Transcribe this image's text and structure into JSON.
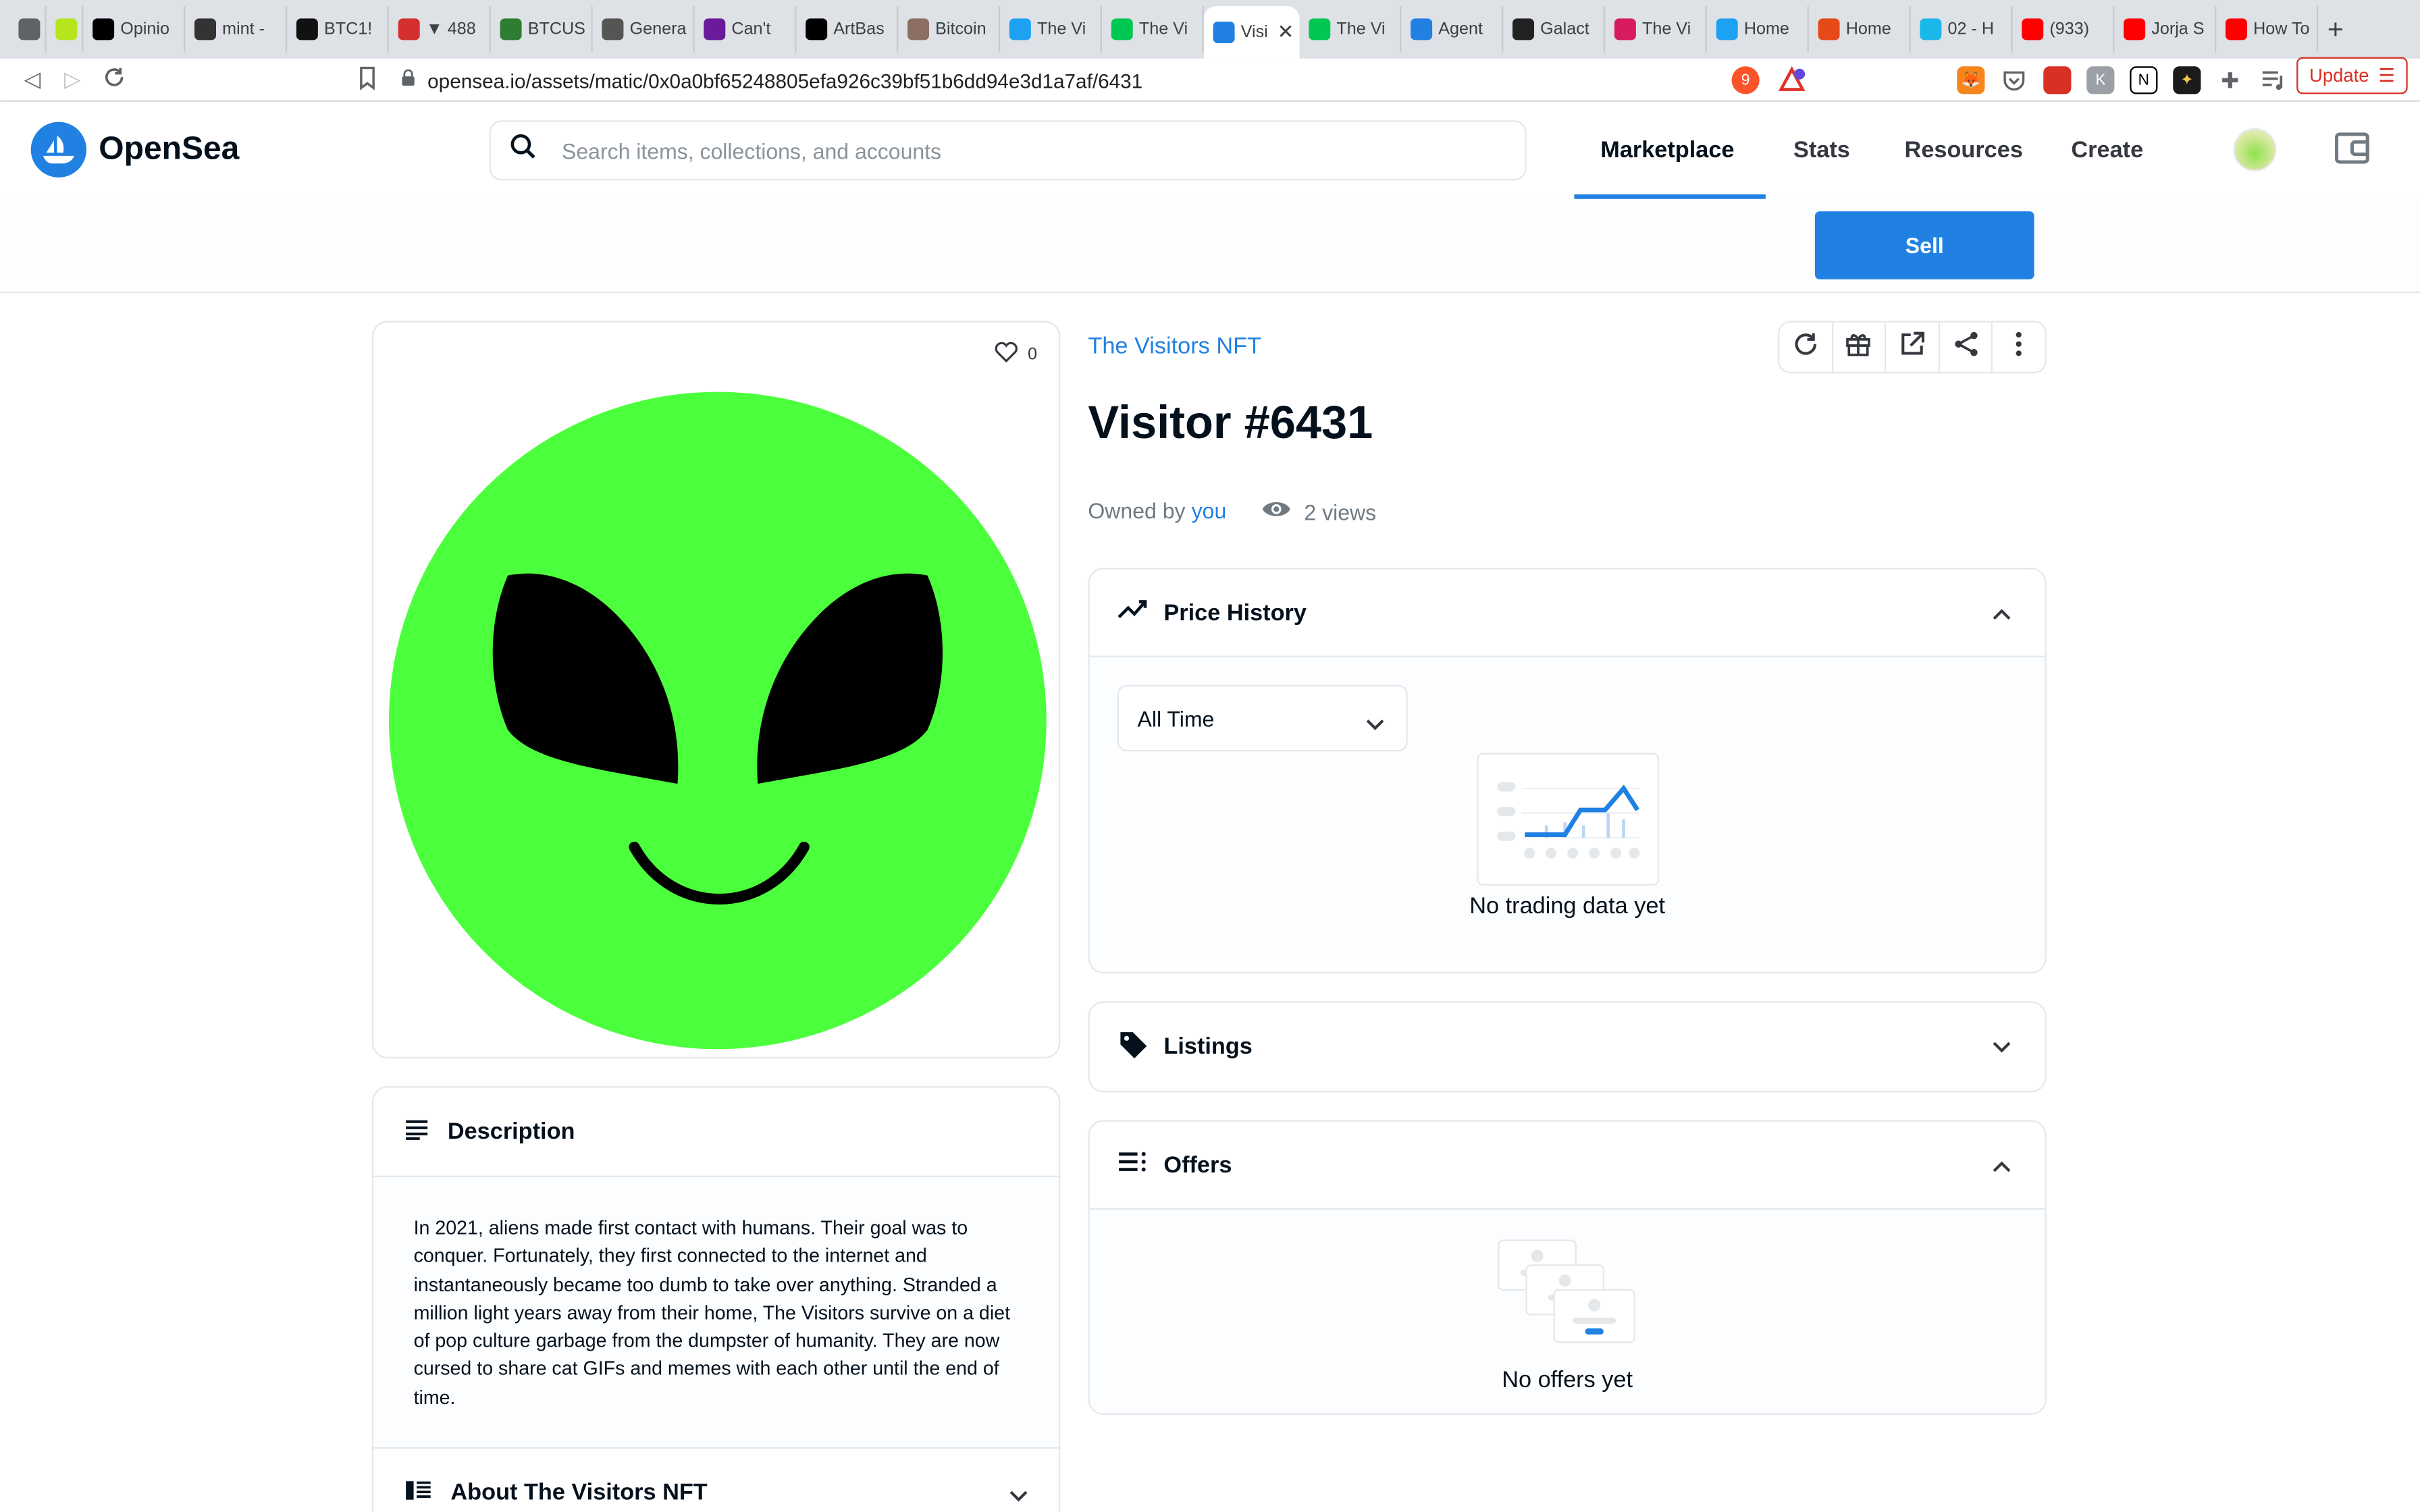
{
  "browser": {
    "tabs": [
      "",
      "",
      "Opinio",
      "mint -",
      "BTC1!",
      "▼ 488",
      "BTCUS",
      "Genera",
      "Can't",
      "ArtBas",
      "Bitcoin",
      "The Vi",
      "The Vi",
      "Visi",
      "The Vi",
      "Agent",
      "Galact",
      "The Vi",
      "Home",
      "Home",
      "02 - H",
      "(933)",
      "Jorja S",
      "How To"
    ],
    "url": "opensea.io/assets/matic/0x0a0bf65248805efa926c39bf51b6dd94e3d1a7af/6431",
    "update_label": "Update",
    "brave_badge": "9",
    "tab_colors": [
      "#5f6368",
      "#b5e61d",
      "#000000",
      "#333333",
      "#111111",
      "#d32f2f",
      "#2e7d32",
      "#555555",
      "#6a1b9a",
      "#000000",
      "#8d6e63",
      "#1da1f2",
      "#00c853",
      "#2081e2",
      "#00c853",
      "#2081e2",
      "#222222",
      "#d81b60",
      "#1da1f2",
      "#e64a19",
      "#1ab7ea",
      "#ff0000",
      "#ff0000",
      "#ff0000"
    ]
  },
  "header": {
    "brand": "OpenSea",
    "search_placeholder": "Search items, collections, and accounts",
    "nav": [
      "Marketplace",
      "Stats",
      "Resources",
      "Create"
    ],
    "active_nav": "Marketplace"
  },
  "sell_label": "Sell",
  "asset": {
    "likes": "0",
    "collection": "The Visitors NFT",
    "title": "Visitor #6431",
    "owned_prefix": "Owned by",
    "owner": "you",
    "views": "2 views",
    "image_color": "#4cff3c"
  },
  "description": {
    "heading": "Description",
    "text": "In 2021, aliens made first contact with humans. Their goal was to conquer. Fortunately, they first connected to the internet and instantaneously became too dumb to take over anything. Stranded a million light years away from their home, The Visitors survive on a diet of pop culture garbage from the dumpster of humanity. They are now cursed to share cat GIFs and memes with each other until the end of time.",
    "about_heading": "About The Visitors NFT"
  },
  "price_history": {
    "heading": "Price History",
    "range": "All Time",
    "empty": "No trading data yet"
  },
  "listings": {
    "heading": "Listings"
  },
  "offers": {
    "heading": "Offers",
    "empty": "No offers yet"
  },
  "colors": {
    "accent": "#2081e2",
    "text": "#04111d",
    "muted": "#707a83"
  }
}
